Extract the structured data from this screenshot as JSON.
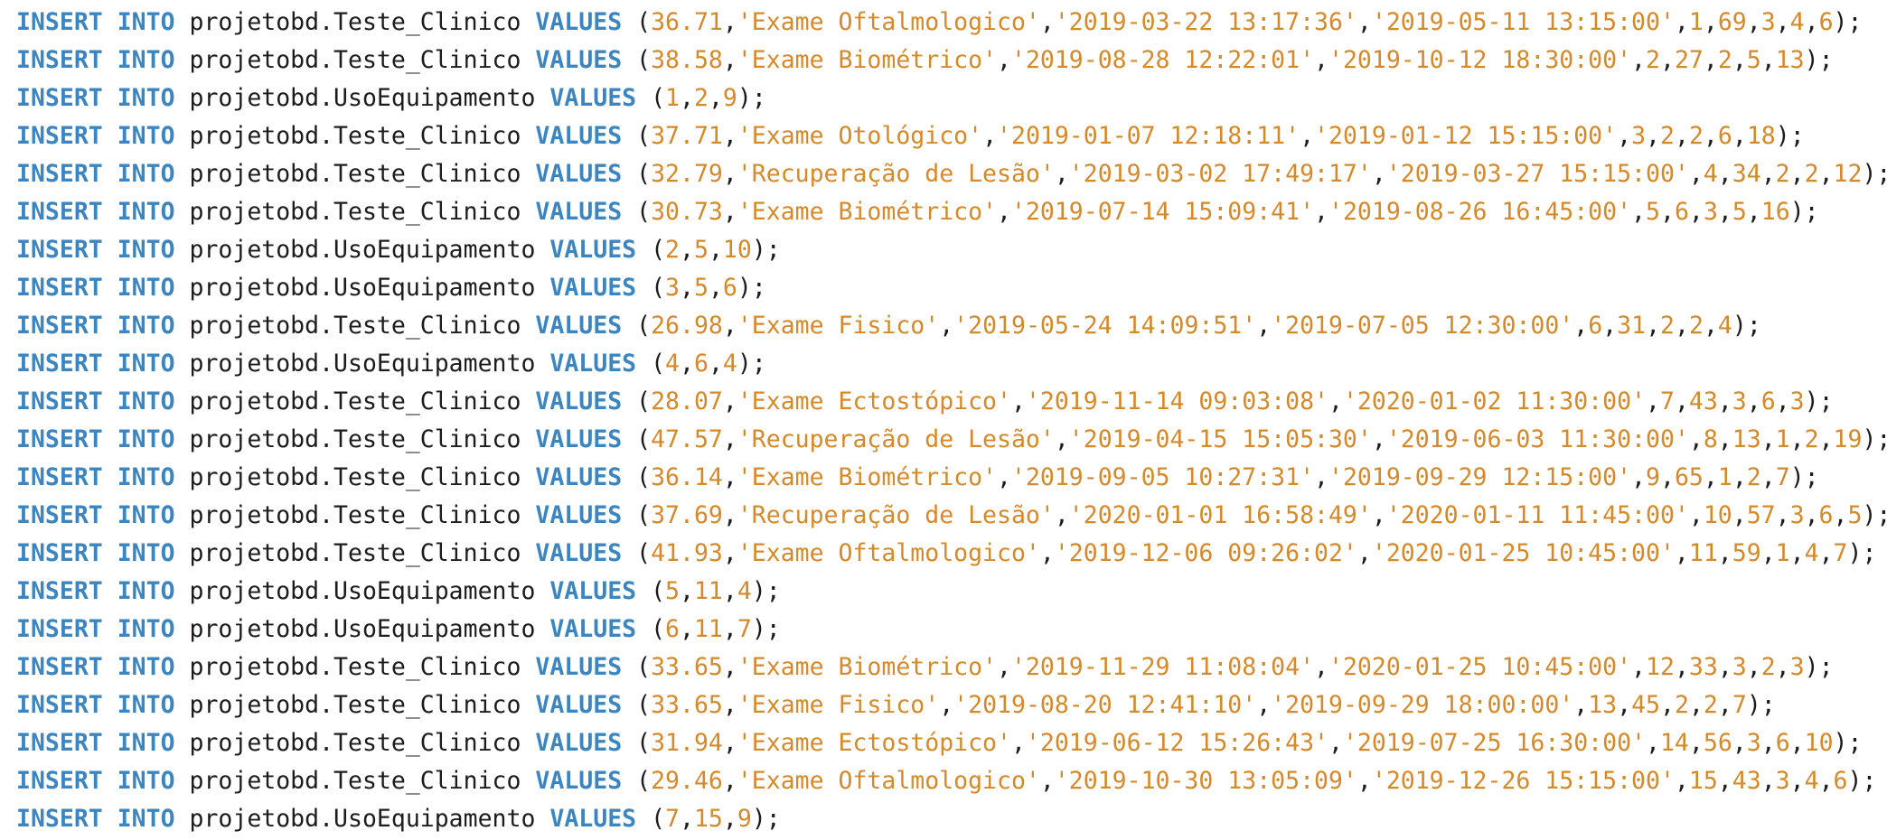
{
  "colors": {
    "background": "#ffffff",
    "keyword": "#3b86c0",
    "identifier": "#1c1c1c",
    "literal": "#d4892a"
  },
  "editor": {
    "lines": [
      {
        "kw1": "INSERT",
        "kw2": "INTO",
        "table": "projetobd.Teste_Clinico",
        "kw3": "VALUES",
        "values": [
          "36.71",
          "'Exame Oftalmologico'",
          "'2019-03-22 13:17:36'",
          "'2019-05-11 13:15:00'",
          "1",
          "69",
          "3",
          "4",
          "6"
        ]
      },
      {
        "kw1": "INSERT",
        "kw2": "INTO",
        "table": "projetobd.Teste_Clinico",
        "kw3": "VALUES",
        "values": [
          "38.58",
          "'Exame Biométrico'",
          "'2019-08-28 12:22:01'",
          "'2019-10-12 18:30:00'",
          "2",
          "27",
          "2",
          "5",
          "13"
        ]
      },
      {
        "kw1": "INSERT",
        "kw2": "INTO",
        "table": "projetobd.UsoEquipamento",
        "kw3": "VALUES",
        "values": [
          "1",
          "2",
          "9"
        ]
      },
      {
        "kw1": "INSERT",
        "kw2": "INTO",
        "table": "projetobd.Teste_Clinico",
        "kw3": "VALUES",
        "values": [
          "37.71",
          "'Exame Otológico'",
          "'2019-01-07 12:18:11'",
          "'2019-01-12 15:15:00'",
          "3",
          "2",
          "2",
          "6",
          "18"
        ]
      },
      {
        "kw1": "INSERT",
        "kw2": "INTO",
        "table": "projetobd.Teste_Clinico",
        "kw3": "VALUES",
        "values": [
          "32.79",
          "'Recuperação de Lesão'",
          "'2019-03-02 17:49:17'",
          "'2019-03-27 15:15:00'",
          "4",
          "34",
          "2",
          "2",
          "12"
        ]
      },
      {
        "kw1": "INSERT",
        "kw2": "INTO",
        "table": "projetobd.Teste_Clinico",
        "kw3": "VALUES",
        "values": [
          "30.73",
          "'Exame Biométrico'",
          "'2019-07-14 15:09:41'",
          "'2019-08-26 16:45:00'",
          "5",
          "6",
          "3",
          "5",
          "16"
        ]
      },
      {
        "kw1": "INSERT",
        "kw2": "INTO",
        "table": "projetobd.UsoEquipamento",
        "kw3": "VALUES",
        "values": [
          "2",
          "5",
          "10"
        ]
      },
      {
        "kw1": "INSERT",
        "kw2": "INTO",
        "table": "projetobd.UsoEquipamento",
        "kw3": "VALUES",
        "values": [
          "3",
          "5",
          "6"
        ]
      },
      {
        "kw1": "INSERT",
        "kw2": "INTO",
        "table": "projetobd.Teste_Clinico",
        "kw3": "VALUES",
        "values": [
          "26.98",
          "'Exame Fisico'",
          "'2019-05-24 14:09:51'",
          "'2019-07-05 12:30:00'",
          "6",
          "31",
          "2",
          "2",
          "4"
        ]
      },
      {
        "kw1": "INSERT",
        "kw2": "INTO",
        "table": "projetobd.UsoEquipamento",
        "kw3": "VALUES",
        "values": [
          "4",
          "6",
          "4"
        ]
      },
      {
        "kw1": "INSERT",
        "kw2": "INTO",
        "table": "projetobd.Teste_Clinico",
        "kw3": "VALUES",
        "values": [
          "28.07",
          "'Exame Ectostópico'",
          "'2019-11-14 09:03:08'",
          "'2020-01-02 11:30:00'",
          "7",
          "43",
          "3",
          "6",
          "3"
        ]
      },
      {
        "kw1": "INSERT",
        "kw2": "INTO",
        "table": "projetobd.Teste_Clinico",
        "kw3": "VALUES",
        "values": [
          "47.57",
          "'Recuperação de Lesão'",
          "'2019-04-15 15:05:30'",
          "'2019-06-03 11:30:00'",
          "8",
          "13",
          "1",
          "2",
          "19"
        ]
      },
      {
        "kw1": "INSERT",
        "kw2": "INTO",
        "table": "projetobd.Teste_Clinico",
        "kw3": "VALUES",
        "values": [
          "36.14",
          "'Exame Biométrico'",
          "'2019-09-05 10:27:31'",
          "'2019-09-29 12:15:00'",
          "9",
          "65",
          "1",
          "2",
          "7"
        ]
      },
      {
        "kw1": "INSERT",
        "kw2": "INTO",
        "table": "projetobd.Teste_Clinico",
        "kw3": "VALUES",
        "values": [
          "37.69",
          "'Recuperação de Lesão'",
          "'2020-01-01 16:58:49'",
          "'2020-01-11 11:45:00'",
          "10",
          "57",
          "3",
          "6",
          "5"
        ]
      },
      {
        "kw1": "INSERT",
        "kw2": "INTO",
        "table": "projetobd.Teste_Clinico",
        "kw3": "VALUES",
        "values": [
          "41.93",
          "'Exame Oftalmologico'",
          "'2019-12-06 09:26:02'",
          "'2020-01-25 10:45:00'",
          "11",
          "59",
          "1",
          "4",
          "7"
        ]
      },
      {
        "kw1": "INSERT",
        "kw2": "INTO",
        "table": "projetobd.UsoEquipamento",
        "kw3": "VALUES",
        "values": [
          "5",
          "11",
          "4"
        ]
      },
      {
        "kw1": "INSERT",
        "kw2": "INTO",
        "table": "projetobd.UsoEquipamento",
        "kw3": "VALUES",
        "values": [
          "6",
          "11",
          "7"
        ]
      },
      {
        "kw1": "INSERT",
        "kw2": "INTO",
        "table": "projetobd.Teste_Clinico",
        "kw3": "VALUES",
        "values": [
          "33.65",
          "'Exame Biométrico'",
          "'2019-11-29 11:08:04'",
          "'2020-01-25 10:45:00'",
          "12",
          "33",
          "3",
          "2",
          "3"
        ]
      },
      {
        "kw1": "INSERT",
        "kw2": "INTO",
        "table": "projetobd.Teste_Clinico",
        "kw3": "VALUES",
        "values": [
          "33.65",
          "'Exame Fisico'",
          "'2019-08-20 12:41:10'",
          "'2019-09-29 18:00:00'",
          "13",
          "45",
          "2",
          "2",
          "7"
        ]
      },
      {
        "kw1": "INSERT",
        "kw2": "INTO",
        "table": "projetobd.Teste_Clinico",
        "kw3": "VALUES",
        "values": [
          "31.94",
          "'Exame Ectostópico'",
          "'2019-06-12 15:26:43'",
          "'2019-07-25 16:30:00'",
          "14",
          "56",
          "3",
          "6",
          "10"
        ]
      },
      {
        "kw1": "INSERT",
        "kw2": "INTO",
        "table": "projetobd.Teste_Clinico",
        "kw3": "VALUES",
        "values": [
          "29.46",
          "'Exame Oftalmologico'",
          "'2019-10-30 13:05:09'",
          "'2019-12-26 15:15:00'",
          "15",
          "43",
          "3",
          "4",
          "6"
        ]
      },
      {
        "kw1": "INSERT",
        "kw2": "INTO",
        "table": "projetobd.UsoEquipamento",
        "kw3": "VALUES",
        "values": [
          "7",
          "15",
          "9"
        ]
      }
    ]
  }
}
